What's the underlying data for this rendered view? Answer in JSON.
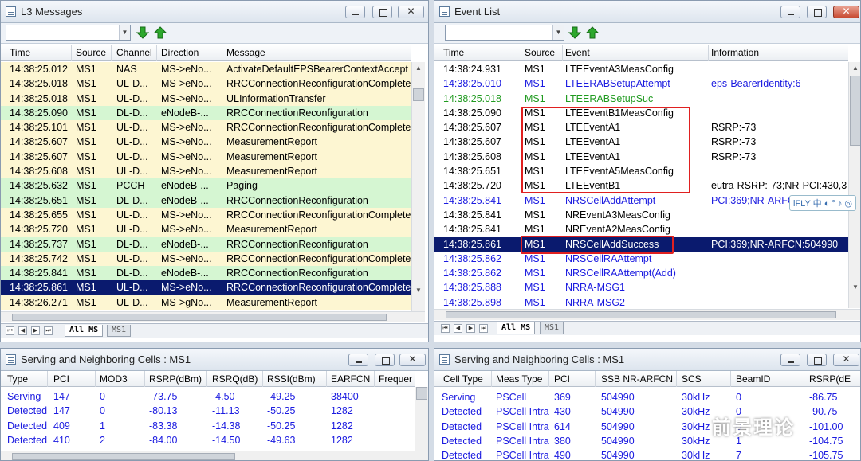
{
  "l3": {
    "title": "L3 Messages",
    "headers": [
      "Time",
      "Source",
      "Channel",
      "Direction",
      "Message"
    ],
    "rows": [
      {
        "time": "14:38:25.012",
        "source": "MS1",
        "channel": "NAS",
        "direction": "MS->eNo...",
        "message": "ActivateDefaultEPSBearerContextAccept",
        "bg": "#fdf6d2"
      },
      {
        "time": "14:38:25.018",
        "source": "MS1",
        "channel": "UL-D...",
        "direction": "MS->eNo...",
        "message": "RRCConnectionReconfigurationComplete",
        "bg": "#fdf6d2"
      },
      {
        "time": "14:38:25.018",
        "source": "MS1",
        "channel": "UL-D...",
        "direction": "MS->eNo...",
        "message": "ULInformationTransfer",
        "bg": "#fdf6d2"
      },
      {
        "time": "14:38:25.090",
        "source": "MS1",
        "channel": "DL-D...",
        "direction": "eNodeB-...",
        "message": "RRCConnectionReconfiguration",
        "bg": "#d5f6d2"
      },
      {
        "time": "14:38:25.101",
        "source": "MS1",
        "channel": "UL-D...",
        "direction": "MS->eNo...",
        "message": "RRCConnectionReconfigurationComplete",
        "bg": "#fdf6d2"
      },
      {
        "time": "14:38:25.607",
        "source": "MS1",
        "channel": "UL-D...",
        "direction": "MS->eNo...",
        "message": "MeasurementReport",
        "bg": "#fdf6d2"
      },
      {
        "time": "14:38:25.607",
        "source": "MS1",
        "channel": "UL-D...",
        "direction": "MS->eNo...",
        "message": "MeasurementReport",
        "bg": "#fdf6d2"
      },
      {
        "time": "14:38:25.608",
        "source": "MS1",
        "channel": "UL-D...",
        "direction": "MS->eNo...",
        "message": "MeasurementReport",
        "bg": "#fdf6d2"
      },
      {
        "time": "14:38:25.632",
        "source": "MS1",
        "channel": "PCCH",
        "direction": "eNodeB-...",
        "message": "Paging",
        "bg": "#d5f6d2"
      },
      {
        "time": "14:38:25.651",
        "source": "MS1",
        "channel": "DL-D...",
        "direction": "eNodeB-...",
        "message": "RRCConnectionReconfiguration",
        "bg": "#d5f6d2"
      },
      {
        "time": "14:38:25.655",
        "source": "MS1",
        "channel": "UL-D...",
        "direction": "MS->eNo...",
        "message": "RRCConnectionReconfigurationComplete",
        "bg": "#fdf6d2"
      },
      {
        "time": "14:38:25.720",
        "source": "MS1",
        "channel": "UL-D...",
        "direction": "MS->eNo...",
        "message": "MeasurementReport",
        "bg": "#fdf6d2"
      },
      {
        "time": "14:38:25.737",
        "source": "MS1",
        "channel": "DL-D...",
        "direction": "eNodeB-...",
        "message": "RRCConnectionReconfiguration",
        "bg": "#d5f6d2"
      },
      {
        "time": "14:38:25.742",
        "source": "MS1",
        "channel": "UL-D...",
        "direction": "MS->eNo...",
        "message": "RRCConnectionReconfigurationComplete",
        "bg": "#fdf6d2"
      },
      {
        "time": "14:38:25.841",
        "source": "MS1",
        "channel": "DL-D...",
        "direction": "eNodeB-...",
        "message": "RRCConnectionReconfiguration",
        "bg": "#d5f6d2"
      },
      {
        "time": "14:38:25.861",
        "source": "MS1",
        "channel": "UL-D...",
        "direction": "MS->eNo...",
        "message": "RRCConnectionReconfigurationComplete",
        "bg": "#0a1a6e",
        "fg": "#ffffff"
      },
      {
        "time": "14:38:26.271",
        "source": "MS1",
        "channel": "UL-D...",
        "direction": "MS->gNo...",
        "message": "MeasurementReport",
        "bg": "#fdf6d2"
      }
    ],
    "tabs": [
      "All MS",
      "MS1"
    ]
  },
  "events": {
    "title": "Event List",
    "headers": [
      "Time",
      "Source",
      "Event",
      "Information"
    ],
    "rows": [
      {
        "time": "14:38:24.931",
        "source": "MS1",
        "event": "LTEEventA3MeasConfig",
        "info": "",
        "fg": "#000000"
      },
      {
        "time": "14:38:25.010",
        "source": "MS1",
        "event": "LTEERABSetupAttempt",
        "info": "eps-BearerIdentity:6",
        "fg": "#1a1ae0"
      },
      {
        "time": "14:38:25.018",
        "source": "MS1",
        "event": "LTEERABSetupSuc",
        "info": "",
        "fg": "#1f9a1f"
      },
      {
        "time": "14:38:25.090",
        "source": "MS1",
        "event": "LTEEventB1MeasConfig",
        "info": "",
        "fg": "#000000"
      },
      {
        "time": "14:38:25.607",
        "source": "MS1",
        "event": "LTEEventA1",
        "info": "RSRP:-73",
        "fg": "#000000"
      },
      {
        "time": "14:38:25.607",
        "source": "MS1",
        "event": "LTEEventA1",
        "info": "RSRP:-73",
        "fg": "#000000"
      },
      {
        "time": "14:38:25.608",
        "source": "MS1",
        "event": "LTEEventA1",
        "info": "RSRP:-73",
        "fg": "#000000"
      },
      {
        "time": "14:38:25.651",
        "source": "MS1",
        "event": "LTEEventA5MeasConfig",
        "info": "",
        "fg": "#000000"
      },
      {
        "time": "14:38:25.720",
        "source": "MS1",
        "event": "LTEEventB1",
        "info": "eutra-RSRP:-73;NR-PCI:430,3",
        "fg": "#000000"
      },
      {
        "time": "14:38:25.841",
        "source": "MS1",
        "event": "NRSCellAddAttempt",
        "info": "PCI:369;NR-ARFC",
        "fg": "#1a1ae0"
      },
      {
        "time": "14:38:25.841",
        "source": "MS1",
        "event": "NREventA3MeasConfig",
        "info": "",
        "fg": "#000000"
      },
      {
        "time": "14:38:25.841",
        "source": "MS1",
        "event": "NREventA2MeasConfig",
        "info": "",
        "fg": "#000000"
      },
      {
        "time": "14:38:25.861",
        "source": "MS1",
        "event": "NRSCellAddSuccess",
        "info": "PCI:369;NR-ARFCN:504990",
        "fg": "#ffffff",
        "bg": "#0a1a6e"
      },
      {
        "time": "14:38:25.862",
        "source": "MS1",
        "event": "NRSCellRAAttempt",
        "info": "",
        "fg": "#1a1ae0"
      },
      {
        "time": "14:38:25.862",
        "source": "MS1",
        "event": "NRSCellRAAttempt(Add)",
        "info": "",
        "fg": "#1a1ae0"
      },
      {
        "time": "14:38:25.888",
        "source": "MS1",
        "event": "NRRA-MSG1",
        "info": "",
        "fg": "#1a1ae0"
      },
      {
        "time": "14:38:25.898",
        "source": "MS1",
        "event": "NRRA-MSG2",
        "info": "",
        "fg": "#1a1ae0"
      }
    ],
    "tabs": [
      "All MS",
      "MS1"
    ]
  },
  "lte_cells": {
    "title": "Serving and Neighboring Cells : MS1",
    "headers": [
      "Type",
      "PCI",
      "MOD3",
      "RSRP(dBm)",
      "RSRQ(dB)",
      "RSSI(dBm)",
      "EARFCN",
      "Frequer"
    ],
    "rows": [
      [
        "Serving",
        "147",
        "0",
        "-73.75",
        "-4.50",
        "-49.25",
        "38400"
      ],
      [
        "Detected",
        "147",
        "0",
        "-80.13",
        "-11.13",
        "-50.25",
        "1282"
      ],
      [
        "Detected",
        "409",
        "1",
        "-83.38",
        "-14.38",
        "-50.25",
        "1282"
      ],
      [
        "Detected",
        "410",
        "2",
        "-84.00",
        "-14.50",
        "-49.63",
        "1282"
      ]
    ]
  },
  "nr_cells": {
    "title": "Serving and Neighboring Cells : MS1",
    "headers": [
      "Cell Type",
      "Meas Type",
      "PCI",
      "SSB NR-ARFCN",
      "SCS",
      "BeamID",
      "RSRP(dE"
    ],
    "rows": [
      [
        "Serving",
        "PSCell",
        "369",
        "504990",
        "30kHz",
        "0",
        "-86.75"
      ],
      [
        "Detected",
        "PSCell Intra",
        "430",
        "504990",
        "30kHz",
        "0",
        "-90.75"
      ],
      [
        "Detected",
        "PSCell Intra",
        "614",
        "504990",
        "30kHz",
        "0",
        "-101.00"
      ],
      [
        "Detected",
        "PSCell Intra",
        "380",
        "504990",
        "30kHz",
        "1",
        "-104.75"
      ],
      [
        "Detected",
        "PSCell Intra",
        "490",
        "504990",
        "30kHz",
        "7",
        "-105.75"
      ]
    ]
  },
  "ime": {
    "label": "iFLY 中 ◐ ° ♪ ◎"
  },
  "watermark": "前景理论",
  "colors": {
    "cell_text": "#1a1ae0",
    "highlight": "#0a1a6e",
    "annotation": "#e02020"
  }
}
